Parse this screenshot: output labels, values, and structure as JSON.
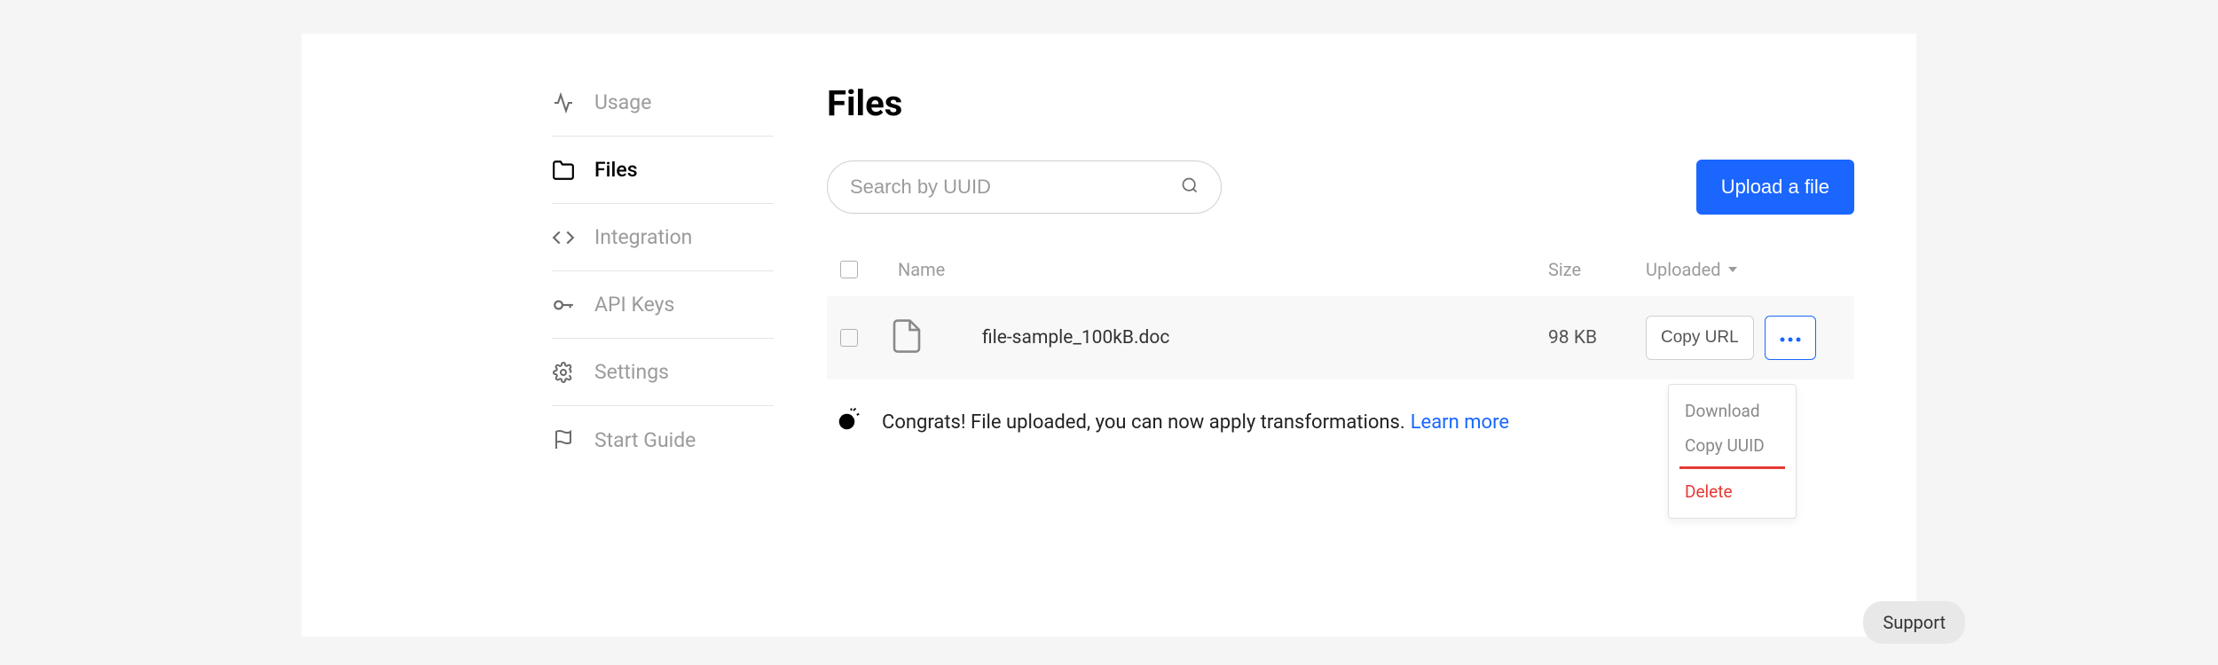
{
  "sidebar": {
    "items": [
      {
        "label": "Usage"
      },
      {
        "label": "Files"
      },
      {
        "label": "Integration"
      },
      {
        "label": "API Keys"
      },
      {
        "label": "Settings"
      },
      {
        "label": "Start Guide"
      }
    ]
  },
  "page": {
    "title": "Files"
  },
  "search": {
    "placeholder": "Search by UUID"
  },
  "buttons": {
    "upload": "Upload a file",
    "copy_url": "Copy URL",
    "support": "Support"
  },
  "table": {
    "headers": {
      "name": "Name",
      "size": "Size",
      "uploaded": "Uploaded"
    },
    "rows": [
      {
        "name": "file-sample_100kB.doc",
        "size": "98 KB"
      }
    ]
  },
  "message": {
    "text": "Congrats! File uploaded, you can now apply transformations.",
    "link": "Learn more"
  },
  "dropdown": {
    "download": "Download",
    "copy_uuid": "Copy UUID",
    "delete": "Delete"
  }
}
